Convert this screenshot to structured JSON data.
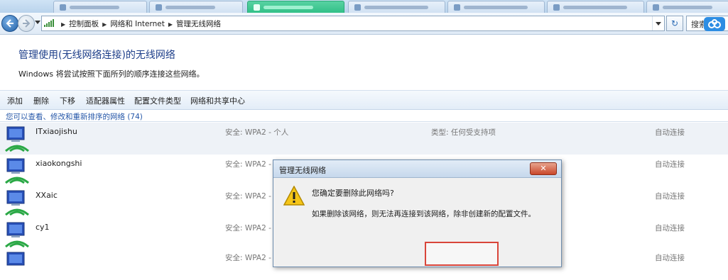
{
  "address_bar": {
    "crumbs": [
      "控制面板",
      "网络和 Internet",
      "管理无线网络"
    ],
    "search_placeholder": "搜索"
  },
  "page": {
    "title": "管理使用(无线网络连接)的无线网络",
    "description": "Windows 将尝试按照下面所列的顺序连接这些网络。"
  },
  "toolbar": {
    "items": [
      "添加",
      "删除",
      "下移",
      "适配器属性",
      "配置文件类型",
      "网络和共享中心"
    ]
  },
  "section": {
    "header": "您可以查看、修改和重新排序的网络 (74)"
  },
  "networks": [
    {
      "ssid": "ITxiaojishu",
      "security": "安全: WPA2 - 个人",
      "type": "类型: 任何受支持项",
      "mode": "自动连接",
      "selected": true
    },
    {
      "ssid": "xiaokongshi",
      "security": "安全: WPA2 -",
      "type": "",
      "mode": "自动连接",
      "selected": false
    },
    {
      "ssid": "XXaic",
      "security": "安全: WPA2 -",
      "type": "",
      "mode": "自动连接",
      "selected": false
    },
    {
      "ssid": "cy1",
      "security": "安全: WPA2 -",
      "type": "",
      "mode": "自动连接",
      "selected": false
    },
    {
      "ssid": "",
      "security": "安全: WPA2 -",
      "type": "",
      "mode": "自动连接",
      "selected": false
    }
  ],
  "dialog": {
    "title": "管理无线网络",
    "question": "您确定要删除此网络吗?",
    "message": "如果删除该网络，则无法再连接到该网络，除非创建新的配置文件。"
  },
  "colors": {
    "title_blue": "#1e3f8a",
    "link_blue": "#2456a8",
    "active_tab": "#2fbf86",
    "highlight": "#d9453a"
  },
  "icons": {
    "back": "back-arrow-icon",
    "forward": "forward-arrow-icon",
    "network": "wireless-network-icon",
    "warning": "warning-icon",
    "close": "close-icon"
  }
}
